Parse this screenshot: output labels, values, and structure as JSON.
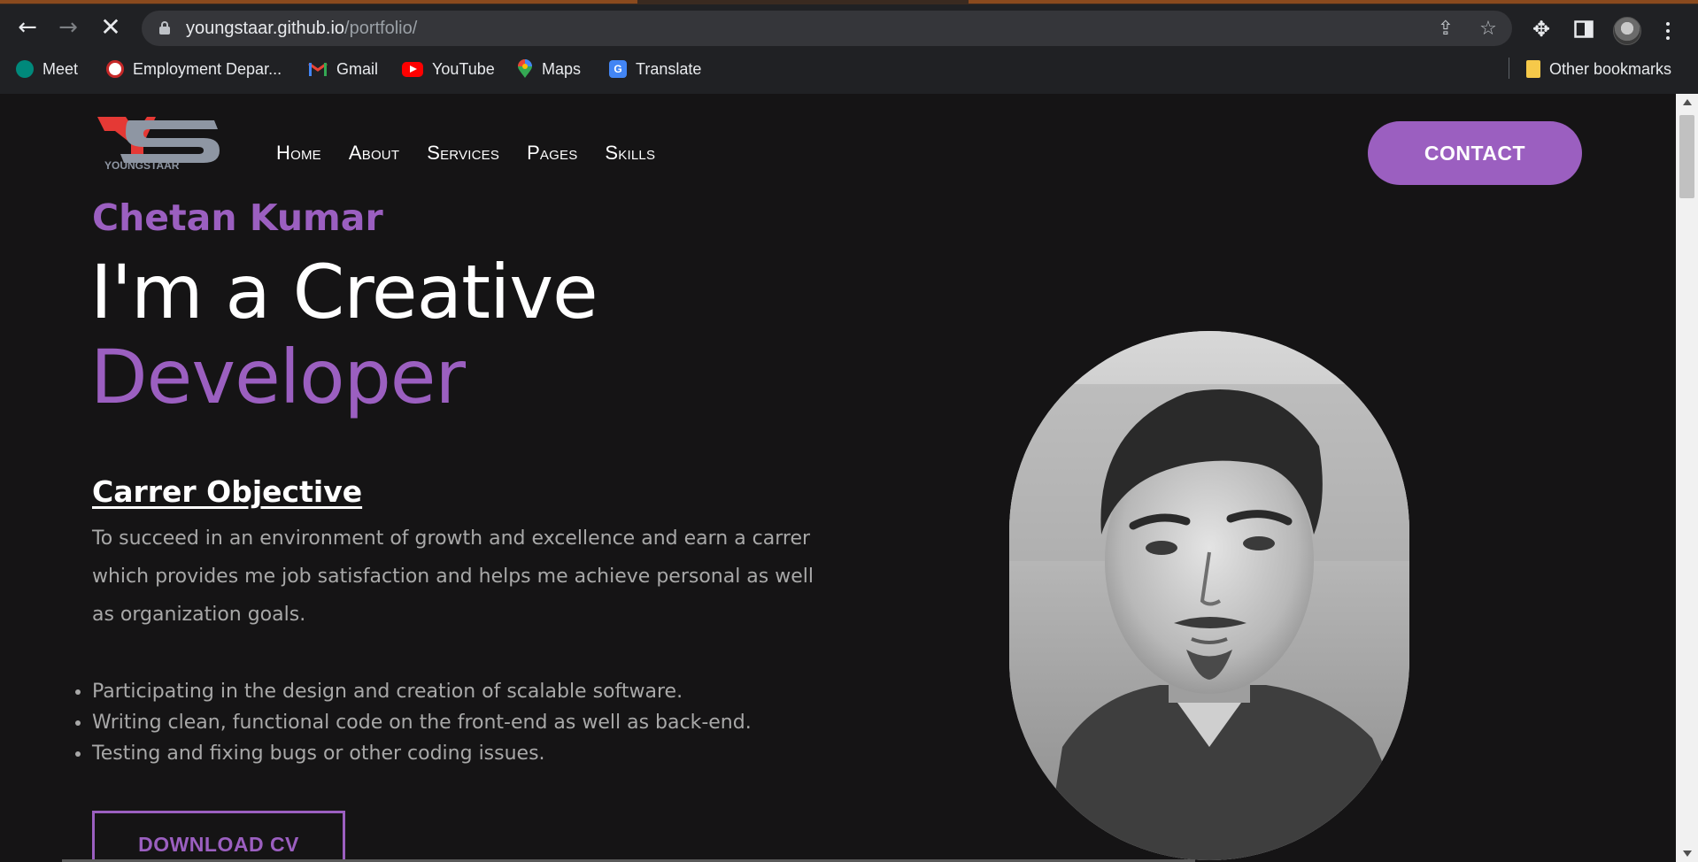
{
  "browser": {
    "url_host": "youngstaar.github.io",
    "url_path": "/portfolio/",
    "bookmarks": [
      {
        "label": "Meet",
        "icon": "meet-icon",
        "color": "#00897b"
      },
      {
        "label": "Employment Depar...",
        "icon": "emblem-icon",
        "color": "#c62828"
      },
      {
        "label": "Gmail",
        "icon": "gmail-icon",
        "color": "#ea4335"
      },
      {
        "label": "YouTube",
        "icon": "youtube-icon",
        "color": "#ff0000"
      },
      {
        "label": "Maps",
        "icon": "maps-icon",
        "color": "#34a853"
      },
      {
        "label": "Translate",
        "icon": "translate-icon",
        "color": "#4285f4"
      }
    ],
    "other_bookmarks": "Other bookmarks"
  },
  "site": {
    "logo_text": "YOUNGSTAAR",
    "nav": [
      "Home",
      "About",
      "Services",
      "Pages",
      "Skills"
    ],
    "contact_label": "CONTACT",
    "name": "Chetan Kumar",
    "headline_1": "I'm a Creative",
    "headline_2": "Developer",
    "objective_title": "Carrer Objective",
    "objective_text": "To succeed in an environment of growth and excellence and earn a carrer which provides me job satisfaction and helps me achieve personal as well as organization goals.",
    "bullets": [
      "Participating in the design and creation of scalable software.",
      "Writing clean, functional code on the front-end as well as back-end.",
      "Testing and fixing bugs or other coding issues."
    ],
    "download_label": "DOWNLOAD CV"
  },
  "colors": {
    "accent": "#9b5fc0",
    "page_bg": "#151415",
    "chrome_bg": "#202124"
  }
}
